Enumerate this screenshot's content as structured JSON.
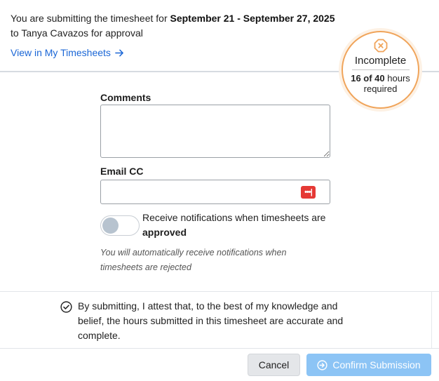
{
  "header": {
    "intro_prefix": "You are submitting the timesheet for ",
    "date_range": "September 21 - September 27, 2025",
    "intro_suffix": "to Tanya Cavazos for approval",
    "view_link": "View in My Timesheets"
  },
  "badge": {
    "status": "Incomplete",
    "hours_bold": "16 of 40",
    "hours_rest": " hours",
    "required": "required",
    "accent_color": "#f0a45a"
  },
  "form": {
    "comments_label": "Comments",
    "comments_value": "",
    "email_cc_label": "Email CC",
    "email_cc_value": "",
    "password_manager_icon": "password-manager-icon",
    "toggle_text_prefix": "Receive notifications when timesheets are ",
    "toggle_text_bold": "approved",
    "toggle_on": false,
    "note": "You will automatically receive notifications when timesheets are rejected"
  },
  "attest": {
    "text": "By submitting, I attest that, to the best of my knowledge and belief, the hours submitted in this timesheet are accurate and complete."
  },
  "footer": {
    "cancel_label": "Cancel",
    "confirm_label": "Confirm Submission",
    "confirm_color": "#8cc4f5"
  }
}
